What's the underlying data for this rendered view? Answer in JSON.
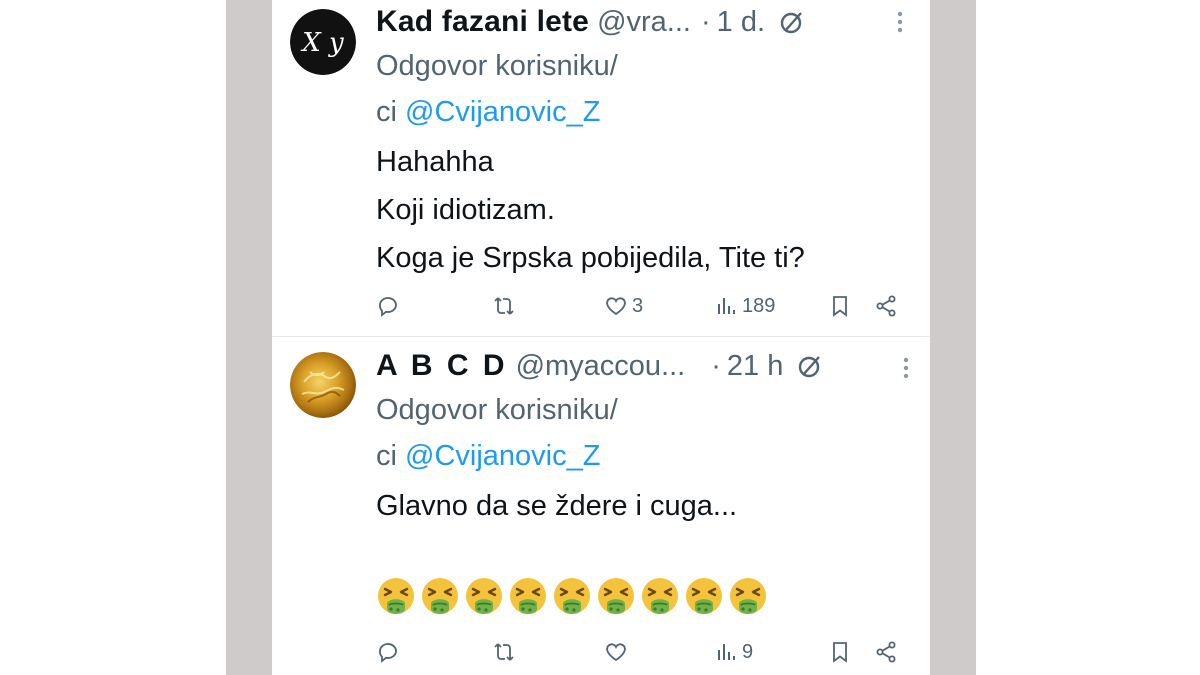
{
  "tweets": [
    {
      "name": "Kad fazani lete",
      "handle": "@vra...",
      "separator": "·",
      "time": "1 d.",
      "reply_prefix_1": "Odgovor korisniku/",
      "reply_prefix_2": "ci",
      "mention": "@Cvijanovic_Z",
      "lines": [
        "Hahahha",
        "Koji idiotizam.",
        "Koga je Srpska pobijedila, Tite ti?"
      ],
      "likes": "3",
      "views": "189",
      "avatar_icon": "xy-logo-avatar",
      "avatar_text": "X y"
    },
    {
      "name": "A B C D",
      "handle": "@myaccou...",
      "separator": "·",
      "time": "21 h",
      "reply_prefix_1": "Odgovor korisniku/",
      "reply_prefix_2": "ci",
      "mention": "@Cvijanovic_Z",
      "lines": [
        "Glavno da se ždere i cuga..."
      ],
      "emoji_count": 9,
      "emoji_icon": "nauseated-face-emoji",
      "likes": "",
      "views": "9",
      "avatar_icon": "gold-texture-avatar"
    }
  ],
  "colors": {
    "side_bars": "#cfcbcb",
    "text": "#0f1419",
    "muted": "#536471",
    "link": "#1d9bf0"
  }
}
